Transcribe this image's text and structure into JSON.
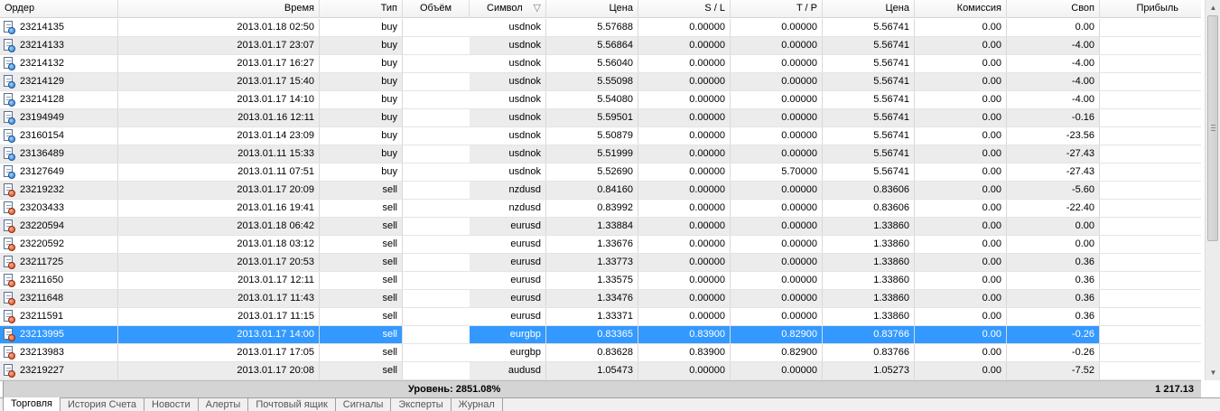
{
  "columns": {
    "order": "Ордер",
    "time": "Время",
    "type": "Тип",
    "volume": "Объём",
    "symbol": "Символ",
    "symbol_sort": "▽",
    "price": "Цена",
    "sl": "S / L",
    "tp": "T / P",
    "price2": "Цена",
    "commission": "Комиссия",
    "swap": "Своп",
    "profit": "Прибыль"
  },
  "rows": [
    {
      "order": "23214135",
      "time": "2013.01.18 02:50",
      "type": "buy",
      "symbol": "usdnok",
      "price": "5.57688",
      "sl": "0.00000",
      "tp": "0.00000",
      "price2": "5.56741",
      "commission": "0.00",
      "swap": "0.00"
    },
    {
      "order": "23214133",
      "time": "2013.01.17 23:07",
      "type": "buy",
      "symbol": "usdnok",
      "price": "5.56864",
      "sl": "0.00000",
      "tp": "0.00000",
      "price2": "5.56741",
      "commission": "0.00",
      "swap": "-4.00"
    },
    {
      "order": "23214132",
      "time": "2013.01.17 16:27",
      "type": "buy",
      "symbol": "usdnok",
      "price": "5.56040",
      "sl": "0.00000",
      "tp": "0.00000",
      "price2": "5.56741",
      "commission": "0.00",
      "swap": "-4.00"
    },
    {
      "order": "23214129",
      "time": "2013.01.17 15:40",
      "type": "buy",
      "symbol": "usdnok",
      "price": "5.55098",
      "sl": "0.00000",
      "tp": "0.00000",
      "price2": "5.56741",
      "commission": "0.00",
      "swap": "-4.00"
    },
    {
      "order": "23214128",
      "time": "2013.01.17 14:10",
      "type": "buy",
      "symbol": "usdnok",
      "price": "5.54080",
      "sl": "0.00000",
      "tp": "0.00000",
      "price2": "5.56741",
      "commission": "0.00",
      "swap": "-4.00"
    },
    {
      "order": "23194949",
      "time": "2013.01.16 12:11",
      "type": "buy",
      "symbol": "usdnok",
      "price": "5.59501",
      "sl": "0.00000",
      "tp": "0.00000",
      "price2": "5.56741",
      "commission": "0.00",
      "swap": "-0.16"
    },
    {
      "order": "23160154",
      "time": "2013.01.14 23:09",
      "type": "buy",
      "symbol": "usdnok",
      "price": "5.50879",
      "sl": "0.00000",
      "tp": "0.00000",
      "price2": "5.56741",
      "commission": "0.00",
      "swap": "-23.56"
    },
    {
      "order": "23136489",
      "time": "2013.01.11 15:33",
      "type": "buy",
      "symbol": "usdnok",
      "price": "5.51999",
      "sl": "0.00000",
      "tp": "0.00000",
      "price2": "5.56741",
      "commission": "0.00",
      "swap": "-27.43"
    },
    {
      "order": "23127649",
      "time": "2013.01.11 07:51",
      "type": "buy",
      "symbol": "usdnok",
      "price": "5.52690",
      "sl": "0.00000",
      "tp": "5.70000",
      "price2": "5.56741",
      "commission": "0.00",
      "swap": "-27.43"
    },
    {
      "order": "23219232",
      "time": "2013.01.17 20:09",
      "type": "sell",
      "symbol": "nzdusd",
      "price": "0.84160",
      "sl": "0.00000",
      "tp": "0.00000",
      "price2": "0.83606",
      "commission": "0.00",
      "swap": "-5.60"
    },
    {
      "order": "23203433",
      "time": "2013.01.16 19:41",
      "type": "sell",
      "symbol": "nzdusd",
      "price": "0.83992",
      "sl": "0.00000",
      "tp": "0.00000",
      "price2": "0.83606",
      "commission": "0.00",
      "swap": "-22.40"
    },
    {
      "order": "23220594",
      "time": "2013.01.18 06:42",
      "type": "sell",
      "symbol": "eurusd",
      "price": "1.33884",
      "sl": "0.00000",
      "tp": "0.00000",
      "price2": "1.33860",
      "commission": "0.00",
      "swap": "0.00"
    },
    {
      "order": "23220592",
      "time": "2013.01.18 03:12",
      "type": "sell",
      "symbol": "eurusd",
      "price": "1.33676",
      "sl": "0.00000",
      "tp": "0.00000",
      "price2": "1.33860",
      "commission": "0.00",
      "swap": "0.00"
    },
    {
      "order": "23211725",
      "time": "2013.01.17 20:53",
      "type": "sell",
      "symbol": "eurusd",
      "price": "1.33773",
      "sl": "0.00000",
      "tp": "0.00000",
      "price2": "1.33860",
      "commission": "0.00",
      "swap": "0.36"
    },
    {
      "order": "23211650",
      "time": "2013.01.17 12:11",
      "type": "sell",
      "symbol": "eurusd",
      "price": "1.33575",
      "sl": "0.00000",
      "tp": "0.00000",
      "price2": "1.33860",
      "commission": "0.00",
      "swap": "0.36"
    },
    {
      "order": "23211648",
      "time": "2013.01.17 11:43",
      "type": "sell",
      "symbol": "eurusd",
      "price": "1.33476",
      "sl": "0.00000",
      "tp": "0.00000",
      "price2": "1.33860",
      "commission": "0.00",
      "swap": "0.36"
    },
    {
      "order": "23211591",
      "time": "2013.01.17 11:15",
      "type": "sell",
      "symbol": "eurusd",
      "price": "1.33371",
      "sl": "0.00000",
      "tp": "0.00000",
      "price2": "1.33860",
      "commission": "0.00",
      "swap": "0.36"
    },
    {
      "order": "23213995",
      "time": "2013.01.17 14:00",
      "type": "sell",
      "symbol": "eurgbp",
      "price": "0.83365",
      "sl": "0.83900",
      "tp": "0.82900",
      "price2": "0.83766",
      "commission": "0.00",
      "swap": "-0.26",
      "selected": true
    },
    {
      "order": "23213983",
      "time": "2013.01.17 17:05",
      "type": "sell",
      "symbol": "eurgbp",
      "price": "0.83628",
      "sl": "0.83900",
      "tp": "0.82900",
      "price2": "0.83766",
      "commission": "0.00",
      "swap": "-0.26"
    },
    {
      "order": "23219227",
      "time": "2013.01.17 20:08",
      "type": "sell",
      "symbol": "audusd",
      "price": "1.05473",
      "sl": "0.00000",
      "tp": "0.00000",
      "price2": "1.05273",
      "commission": "0.00",
      "swap": "-7.52"
    }
  ],
  "totals": {
    "level": "Уровень: 2851.08%",
    "profit": "1 217.13"
  },
  "tabs": [
    {
      "label": "Торговля",
      "active": true
    },
    {
      "label": "История Счета"
    },
    {
      "label": "Новости"
    },
    {
      "label": "Алерты"
    },
    {
      "label": "Почтовый ящик"
    },
    {
      "label": "Сигналы"
    },
    {
      "label": "Эксперты"
    },
    {
      "label": "Журнал"
    }
  ],
  "icons": {
    "buy": "buy-order-icon",
    "sell": "sell-order-icon"
  },
  "colors": {
    "selection": "#3399ff",
    "alt_row": "#ececec",
    "totals_bar": "#d4d4d4"
  }
}
